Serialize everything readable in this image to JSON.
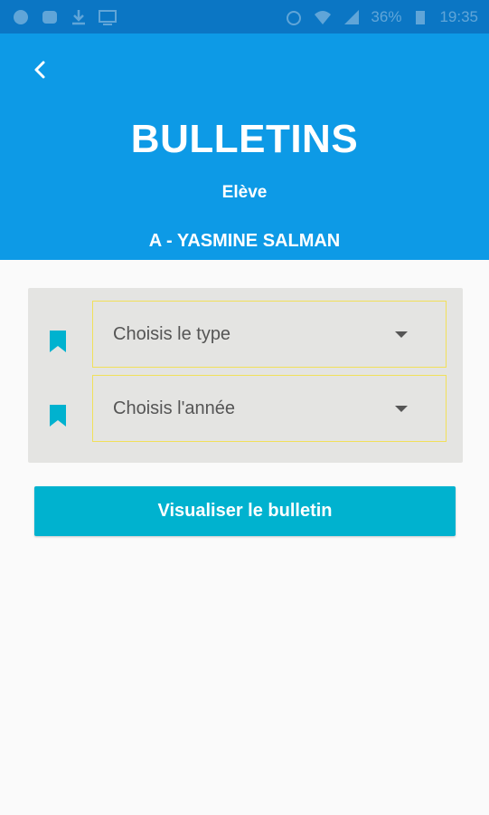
{
  "status_bar": {
    "battery": "36%",
    "time": "19:35"
  },
  "header": {
    "title": "BULLETINS",
    "subtitle": "Elève",
    "student_name": "A - YASMINE SALMAN"
  },
  "filters": {
    "type_select": {
      "label": "Choisis le type"
    },
    "year_select": {
      "label": "Choisis l'année"
    }
  },
  "actions": {
    "view_button": "Visualiser le bulletin"
  },
  "colors": {
    "header_bg": "#0d9ae6",
    "status_bar_bg": "#0b76c4",
    "button_bg": "#00b2cf",
    "bookmark_icon": "#00b2cf",
    "select_border": "#f1e05a"
  },
  "icons": [
    "back-arrow-icon",
    "bookmark-icon",
    "dropdown-caret-icon"
  ]
}
